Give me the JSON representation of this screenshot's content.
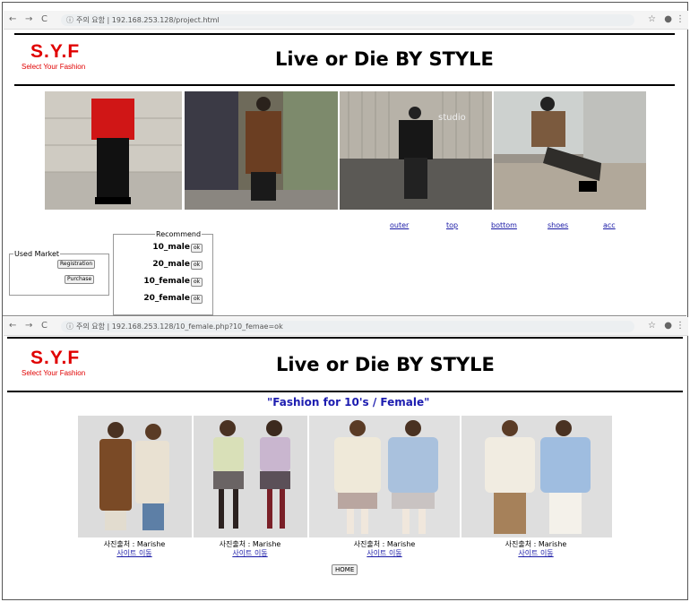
{
  "browser1": {
    "url_prefix": "주의 요함",
    "url": "192.168.253.128/project.html"
  },
  "browser2": {
    "url_prefix": "주의 요함",
    "url": "192.168.253.128/10_female.php?10_femae=ok"
  },
  "logo": {
    "main": "S.Y.F",
    "sub": "Select Your Fashion"
  },
  "title": "Live or Die BY STYLE",
  "menu": [
    "outer",
    "top",
    "bottom",
    "shoes",
    "acc"
  ],
  "used_market": {
    "legend": "Used Market",
    "registration": "Registration",
    "purchase": "Purchase"
  },
  "recommend": {
    "legend": "Recommend",
    "items": [
      {
        "label": "10_male",
        "btn": "ok"
      },
      {
        "label": "20_male",
        "btn": "ok"
      },
      {
        "label": "10_female",
        "btn": "ok"
      },
      {
        "label": "20_female",
        "btn": "ok"
      }
    ]
  },
  "subtitle": "\"Fashion for 10's / Female\"",
  "credits": [
    {
      "text": "사진출처 : Marishe",
      "link": "사이트 이동"
    },
    {
      "text": "사진출처 : Marishe",
      "link": "사이트 이동"
    },
    {
      "text": "사진출처 : Marishe",
      "link": "사이트 이동"
    },
    {
      "text": "사진출처 : Marishe",
      "link": "사이트 이동"
    }
  ],
  "home_button": "HOME",
  "icons": [
    "back-arrow-icon",
    "forward-arrow-icon",
    "reload-icon",
    "info-icon",
    "star-icon",
    "account-icon",
    "menu-dots-icon"
  ]
}
